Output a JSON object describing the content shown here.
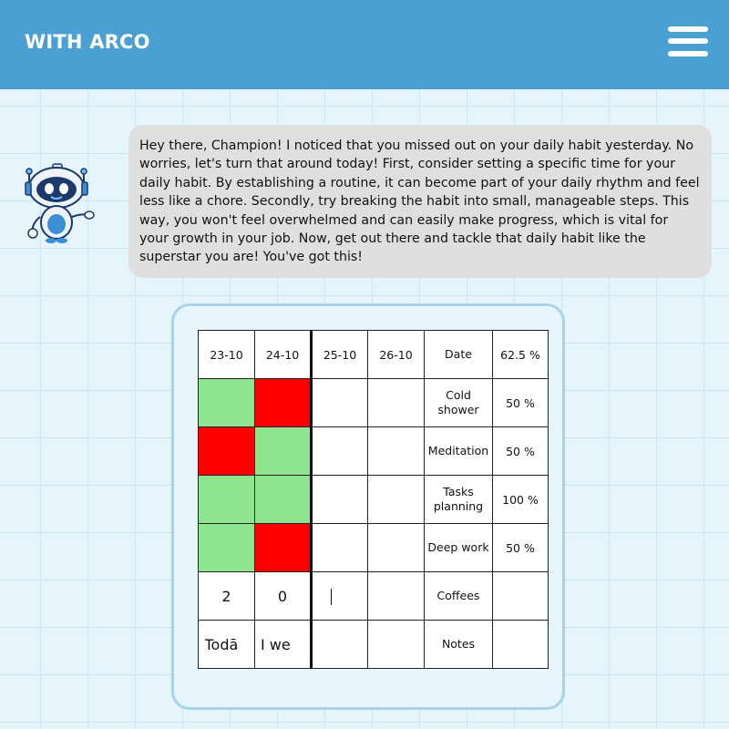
{
  "header": {
    "brand": "WITH ARCO",
    "menu_icon": "hamburger-menu-icon",
    "background": "#4a9fd3"
  },
  "assistant": {
    "avatar_icon": "robot-mascot-icon",
    "message": "Hey there, Champion! I noticed that you missed out on your daily habit yesterday. No worries, let's turn that around today! First, consider setting a specific time for your daily habit. By establishing a routine, it can become part of your daily rhythm and feel less like a chore. Secondly, try breaking the habit into small, manageable steps. This way, you won't feel overwhelmed and can easily make progress, which is vital for your growth in your job. Now, get out there and tackle that daily habit like the superstar you are! You've got this!"
  },
  "tracker": {
    "dates": [
      "23-10",
      "24-10",
      "25-10",
      "26-10"
    ],
    "date_label": "Date",
    "overall_pct": "62.5 %",
    "habits": [
      {
        "label": "Cold shower",
        "pct": "50 %",
        "days": [
          "done",
          "missed",
          "empty",
          "empty"
        ]
      },
      {
        "label": "Meditation",
        "pct": "50 %",
        "days": [
          "missed",
          "done",
          "empty",
          "empty"
        ]
      },
      {
        "label": "Tasks planning",
        "pct": "100 %",
        "days": [
          "done",
          "done",
          "empty",
          "empty"
        ]
      },
      {
        "label": "Deep work",
        "pct": "50 %",
        "days": [
          "done",
          "missed",
          "empty",
          "empty"
        ]
      }
    ],
    "coffees": {
      "label": "Coffees",
      "values": [
        "2",
        "0",
        "",
        ""
      ]
    },
    "notes": {
      "label": "Notes",
      "values": [
        "Todā",
        "I we",
        "",
        ""
      ]
    },
    "colors": {
      "done": "#8fe58f",
      "missed": "#ff0000",
      "empty": "#ffffff"
    }
  }
}
